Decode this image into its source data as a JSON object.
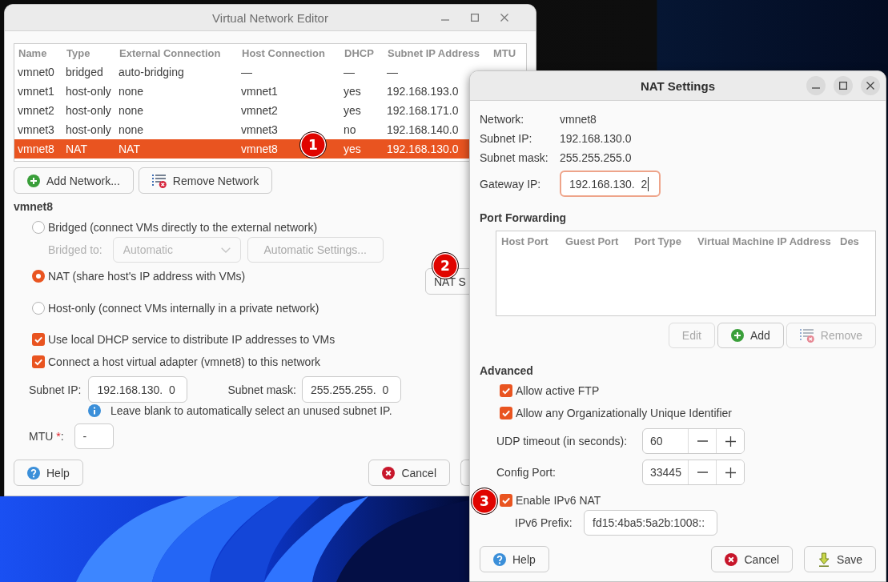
{
  "editor": {
    "title": "Virtual Network Editor",
    "active": false,
    "table": {
      "columns": [
        "Name",
        "Type",
        "External Connection",
        "Host Connection",
        "DHCP",
        "Subnet IP Address",
        "MTU"
      ],
      "rows": [
        {
          "cells": [
            "vmnet0",
            "bridged",
            "auto-bridging",
            "—",
            "—",
            "—"
          ],
          "selected": false
        },
        {
          "cells": [
            "vmnet1",
            "host-only",
            "none",
            "vmnet1",
            "yes",
            "192.168.193.0"
          ],
          "selected": false
        },
        {
          "cells": [
            "vmnet2",
            "host-only",
            "none",
            "vmnet2",
            "yes",
            "192.168.171.0"
          ],
          "selected": false
        },
        {
          "cells": [
            "vmnet3",
            "host-only",
            "none",
            "vmnet3",
            "no",
            "192.168.140.0"
          ],
          "selected": false
        },
        {
          "cells": [
            "vmnet8",
            "NAT",
            "NAT",
            "vmnet8",
            "yes",
            "192.168.130.0"
          ],
          "selected": true
        }
      ]
    },
    "buttons": [
      {
        "label": "Add Network...",
        "kind": "add"
      },
      {
        "label": "Remove Network",
        "kind": "remove"
      }
    ],
    "network_label": "vmnet8",
    "modes": [
      {
        "label": "Bridged (connect VMs directly to the external network)",
        "selected": false,
        "bridged_to": {
          "label": "Bridged to:",
          "value": "Automatic",
          "button": "Automatic Settings...",
          "disabled": true
        }
      },
      {
        "label": "NAT (share host's IP address with VMs)",
        "selected": true,
        "button": "NAT S"
      },
      {
        "label": "Host-only (connect VMs internally in a private network)",
        "selected": false
      }
    ],
    "checkboxes": [
      {
        "label": "Use local DHCP service to distribute IP addresses to VMs",
        "checked": true
      },
      {
        "label": "Connect a host virtual adapter (vmnet8) to this network",
        "checked": true
      }
    ],
    "subnet_ip": {
      "label": "Subnet IP:",
      "value": "192.168.130.  0"
    },
    "subnet_mask": {
      "label": "Subnet mask:",
      "value": "255.255.255.  0"
    },
    "hint": "Leave blank to automatically select an unused subnet IP.",
    "mtu": {
      "label": "MTU",
      "required_mark": "*",
      "label_end": ":",
      "value": "-"
    },
    "footer_buttons": [
      {
        "label": "Help",
        "kind": "help"
      },
      {
        "label": "Cancel",
        "kind": "cancel"
      },
      {
        "kind": "covered"
      }
    ]
  },
  "nat_settings": {
    "title": "NAT Settings",
    "active": true,
    "info": [
      {
        "label": "Network:",
        "value": "vmnet8"
      },
      {
        "label": "Subnet IP:",
        "value": "192.168.130.0"
      },
      {
        "label": "Subnet mask:",
        "value": "255.255.255.0"
      }
    ],
    "gateway": {
      "label": "Gateway IP:",
      "value": "192.168.130.  2",
      "focused": true
    },
    "port_forwarding": {
      "heading": "Port Forwarding",
      "columns": [
        "Host Port",
        "Guest Port",
        "Port Type",
        "Virtual Machine IP Address",
        "Des"
      ],
      "buttons": [
        {
          "label": "Edit",
          "kind": "edit",
          "disabled": true
        },
        {
          "label": "Add",
          "kind": "add",
          "disabled": false
        },
        {
          "label": "Remove",
          "kind": "remove",
          "disabled": true
        }
      ]
    },
    "advanced": {
      "heading": "Advanced",
      "items": [
        {
          "kind": "checkbox",
          "label": "Allow active FTP",
          "checked": true
        },
        {
          "kind": "checkbox",
          "label": "Allow any Organizationally Unique Identifier",
          "checked": true
        },
        {
          "kind": "spin",
          "label": "UDP timeout (in seconds):",
          "value": "60"
        },
        {
          "kind": "spin",
          "label": "Config Port:",
          "value": "33445"
        },
        {
          "kind": "checkbox",
          "label": "Enable IPv6 NAT",
          "checked": true
        },
        {
          "kind": "text_field",
          "label": "IPv6 Prefix:",
          "value": "fd15:4ba5:5a2b:1008::"
        }
      ]
    },
    "footer_buttons": [
      {
        "label": "Help",
        "kind": "help"
      },
      {
        "label": "Cancel",
        "kind": "cancel"
      },
      {
        "label": "Save",
        "kind": "save"
      }
    ]
  },
  "annotations": [
    {
      "label": "1"
    },
    {
      "label": "2"
    },
    {
      "label": "3"
    }
  ]
}
